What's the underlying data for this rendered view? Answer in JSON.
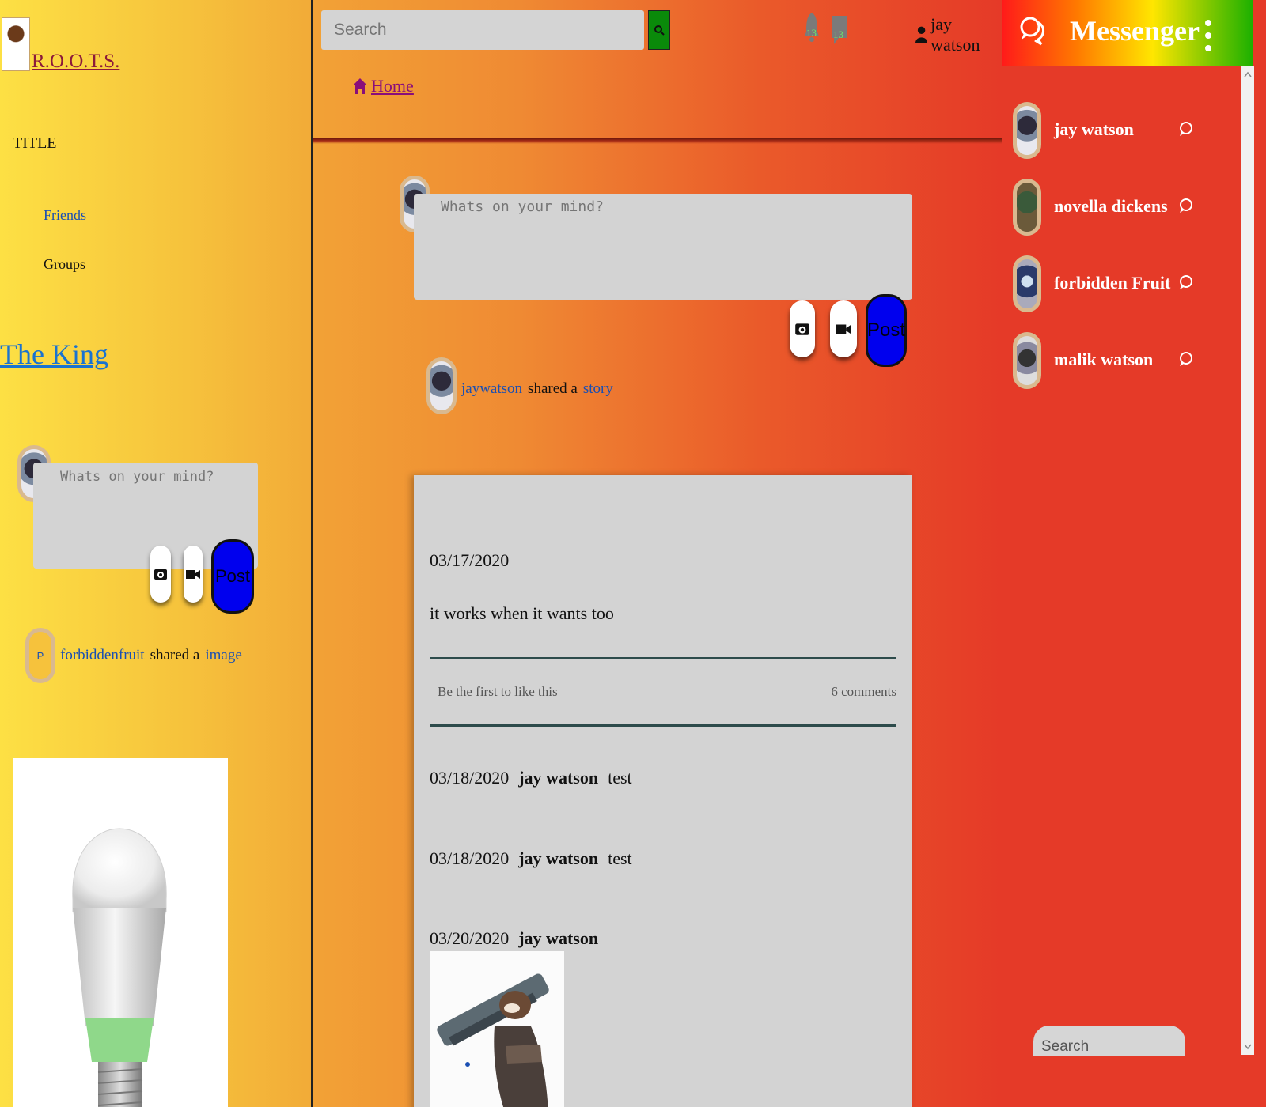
{
  "sidebar": {
    "logo_text": "R.O.O.T.S.",
    "title": "TITLE",
    "nav": {
      "friends": "Friends",
      "groups": "Groups"
    },
    "king_link": "The King",
    "composer": {
      "placeholder": "Whats on your mind?",
      "post_label": "Post"
    },
    "shared": {
      "initial": "P",
      "user": "forbiddenfruit",
      "verb": "shared a",
      "object": "image"
    }
  },
  "topbar": {
    "search_placeholder": "Search",
    "notifications_count": "13",
    "messages_count": "13",
    "username": "jay watson"
  },
  "breadcrumb": {
    "home": "Home"
  },
  "composer": {
    "placeholder": "Whats on your mind?",
    "post_label": "Post"
  },
  "feed": {
    "shared": {
      "user": "jaywatson",
      "verb": "shared a",
      "object": "story"
    },
    "post": {
      "date": "03/17/2020",
      "text": "it works when it wants too",
      "likes_text": "Be the first to like this",
      "comments_text": "6 comments",
      "comments": [
        {
          "date": "03/18/2020",
          "author": "jay watson",
          "text": "test"
        },
        {
          "date": "03/18/2020",
          "author": "jay watson",
          "text": "test"
        },
        {
          "date": "03/20/2020",
          "author": "jay watson",
          "text": ""
        }
      ]
    }
  },
  "messenger": {
    "title": "Messenger",
    "contacts": [
      {
        "name": "jay watson"
      },
      {
        "name": "novella dickens"
      },
      {
        "name": "forbidden Fruit"
      },
      {
        "name": "malik watson"
      }
    ],
    "search_placeholder": "Search"
  },
  "colors": {
    "post_button": "#0000ee",
    "search_button": "#0a8a0a",
    "badge": "#6be36b"
  }
}
